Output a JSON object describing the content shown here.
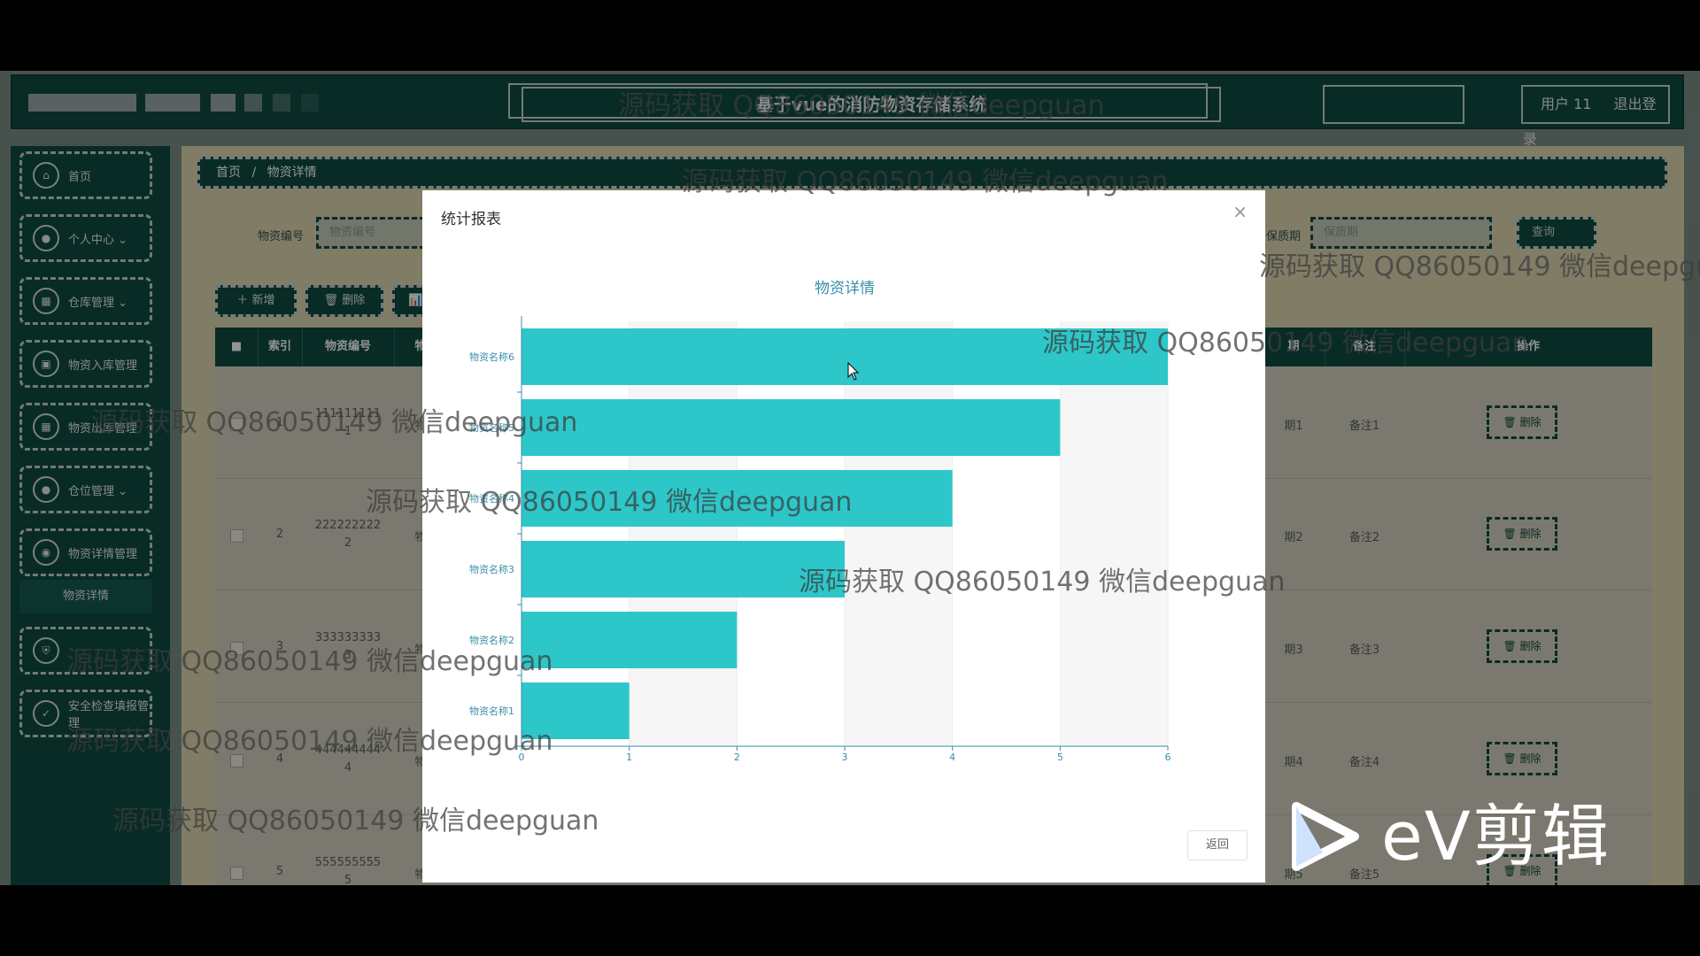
{
  "header": {
    "title": "基于vue的消防物资存储系统",
    "user": "用户 11",
    "logout": "退出登录"
  },
  "sidebar": {
    "items": [
      {
        "label": "首页",
        "icon": "home-icon"
      },
      {
        "label": "个人中心 ⌄",
        "icon": "user-icon"
      },
      {
        "label": "仓库管理 ⌄",
        "icon": "grid-icon"
      },
      {
        "label": "物资入库管理",
        "icon": "box-icon"
      },
      {
        "label": "物资出库管理",
        "icon": "grid-icon"
      },
      {
        "label": "仓位管理 ⌄",
        "icon": "user-icon"
      },
      {
        "label": "物资详情管理",
        "icon": "location-icon"
      }
    ],
    "submenu_label": "物资详情",
    "items_lower": [
      {
        "label": "",
        "icon": "shield-icon"
      },
      {
        "label": "安全检查填报管理",
        "icon": "check-icon"
      }
    ]
  },
  "breadcrumb": {
    "home": "首页",
    "separator": "/",
    "current": "物资详情"
  },
  "search": {
    "code_label": "物资编号",
    "code_placeholder": "物资编号",
    "shelf_label": "保质期",
    "shelf_placeholder": "保质期",
    "query_button": "查询"
  },
  "toolbar": {
    "add": "＋ 新增",
    "delete": "🗑 删除",
    "stats": "📊 统"
  },
  "table": {
    "headers": {
      "index": "索引",
      "code": "物资编号",
      "name": "物",
      "date": "期",
      "remark": "备注",
      "action": "操作"
    },
    "rows": [
      {
        "index": "1",
        "code": "111111111\n1",
        "date": "期1",
        "remark": "备注1"
      },
      {
        "index": "2",
        "code": "222222222\n2",
        "date": "期2",
        "remark": "备注2"
      },
      {
        "index": "3",
        "code": "333333333\n3",
        "date": "期3",
        "remark": "备注3"
      },
      {
        "index": "4",
        "code": "444444444\n4",
        "date": "期4",
        "remark": "备注4"
      },
      {
        "index": "5",
        "code": "555555555\n5",
        "date": "期5",
        "remark": "备注5"
      }
    ],
    "delete_label": "🗑 删除",
    "name_partial": "物"
  },
  "modal": {
    "title": "统计报表",
    "close": "×",
    "back_button": "返回"
  },
  "chart_data": {
    "type": "bar",
    "orientation": "horizontal",
    "title": "物资详情",
    "categories": [
      "物资名称1",
      "物资名称2",
      "物资名称3",
      "物资名称4",
      "物资名称5",
      "物资名称6"
    ],
    "values": [
      1,
      2,
      3,
      4,
      5,
      6
    ],
    "xlim": [
      0,
      6
    ],
    "xticks": [
      "0",
      "1",
      "2",
      "3",
      "4",
      "5",
      "6"
    ],
    "color": "#2ec7c9",
    "grid": true
  },
  "watermark": "源码获取 QQ86050149 微信deepguan",
  "branding": {
    "ev_text": "eV剪辑"
  },
  "colors": {
    "primary": "#0e4a42",
    "bar": "#2ec7c9",
    "text_blue": "#3a8ea9"
  }
}
